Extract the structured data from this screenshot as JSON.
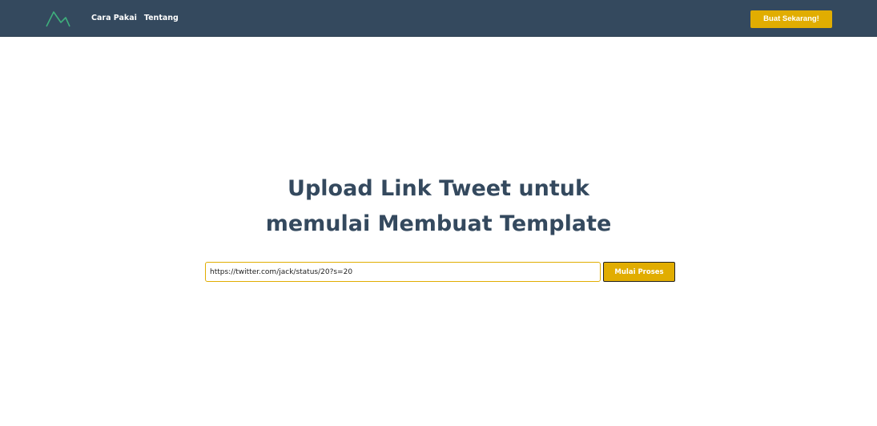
{
  "navbar": {
    "logo_icon": "mountain-logo-icon",
    "links": [
      {
        "label": "Cara Pakai"
      },
      {
        "label": "Tentang"
      }
    ],
    "cta_label": "Buat Sekarang!"
  },
  "hero": {
    "title_line1": "Upload Link Tweet untuk",
    "title_line2": "memulai Membuat Template"
  },
  "form": {
    "url_value": "https://twitter.com/jack/status/20?s=20",
    "submit_label": "Mulai Proses"
  },
  "colors": {
    "navbar_bg": "#34495e",
    "accent": "#e1ad01",
    "logo": "#3eaf7c",
    "title": "#34495e"
  }
}
